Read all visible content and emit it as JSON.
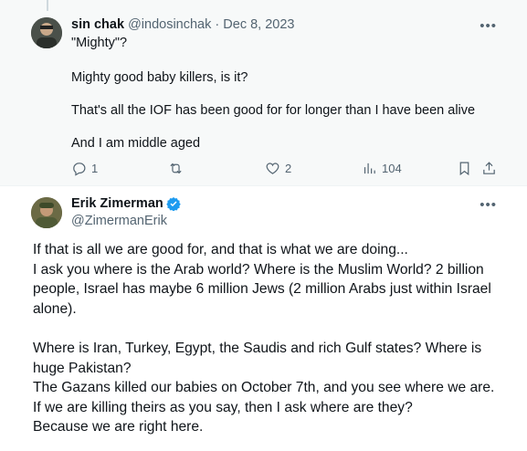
{
  "reply": {
    "name": "sin chak",
    "handle": "@indosinchak",
    "separator": "·",
    "date": "Dec 8, 2023",
    "lines": [
      "\"Mighty\"?",
      "Mighty good baby killers, is it?",
      "That's all the IOF has been good for for longer than I have been alive",
      "And I am middle aged"
    ],
    "actions": {
      "replies": "1",
      "reposts": "",
      "likes": "2",
      "views": "104"
    }
  },
  "main": {
    "name": "Erik Zimerman",
    "handle": "@ZimermanErik",
    "paragraphs": [
      [
        "If that is all we are good for, and that is what we are doing...",
        "I ask you where is the Arab world? Where is the Muslim World? 2 billion",
        "people, Israel has maybe 6 million Jews (2 million Arabs just within Israel",
        "alone)."
      ],
      [
        "Where is Iran, Turkey, Egypt, the Saudis and rich Gulf states? Where is",
        "huge Pakistan?",
        "The Gazans killed our babies on October 7th, and you see where we are.",
        "If we are killing theirs as you say, then I ask where are they?",
        "Because we are right here."
      ]
    ]
  },
  "colors": {
    "text": "#0f1419",
    "muted": "#536471",
    "verified": "#1d9bf0",
    "reply_bg": "#f7f9f9"
  }
}
